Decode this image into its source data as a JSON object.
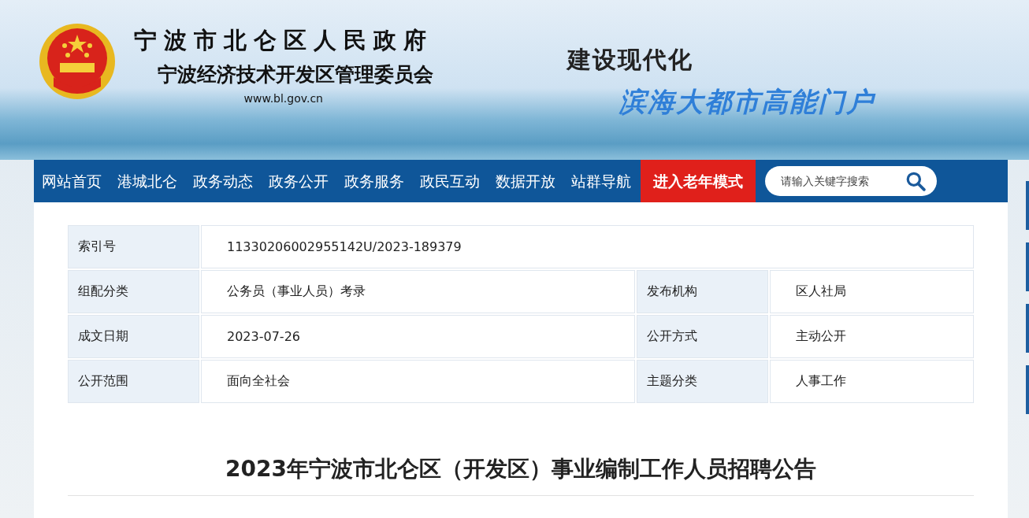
{
  "header": {
    "title_line_1": "宁波市北仑区人民政府",
    "title_line_2": "宁波经济技术开发区管理委员会",
    "url": "www.bl.gov.cn",
    "slogan_1": "建设现代化",
    "slogan_2": "滨海大都市高能门户"
  },
  "nav": {
    "items": [
      {
        "label": "网站首页",
        "kind": "link"
      },
      {
        "label": "港城北仑",
        "kind": "link"
      },
      {
        "label": "政务动态",
        "kind": "link"
      },
      {
        "label": "政务公开",
        "kind": "link"
      },
      {
        "label": "政务服务",
        "kind": "link"
      },
      {
        "label": "政民互动",
        "kind": "link"
      },
      {
        "label": "数据开放",
        "kind": "link"
      },
      {
        "label": "站群导航",
        "kind": "link"
      },
      {
        "label": "进入老年模式",
        "kind": "highlight"
      }
    ],
    "search": {
      "placeholder": "请输入关键字搜索"
    }
  },
  "info_table": {
    "rows": [
      [
        {
          "label": "索引号",
          "value": "11330206002955142U/2023-189379"
        }
      ],
      [
        {
          "label": "组配分类",
          "value": "公务员（事业人员）考录"
        },
        {
          "label": "发布机构",
          "value": "区人社局"
        }
      ],
      [
        {
          "label": "成文日期",
          "value": "2023-07-26"
        },
        {
          "label": "公开方式",
          "value": "主动公开"
        }
      ],
      [
        {
          "label": "公开范围",
          "value": "面向全社会"
        },
        {
          "label": "主题分类",
          "value": "人事工作"
        }
      ]
    ]
  },
  "article": {
    "title": "2023年宁波市北仑区（开发区）事业编制工作人员招聘公告"
  }
}
